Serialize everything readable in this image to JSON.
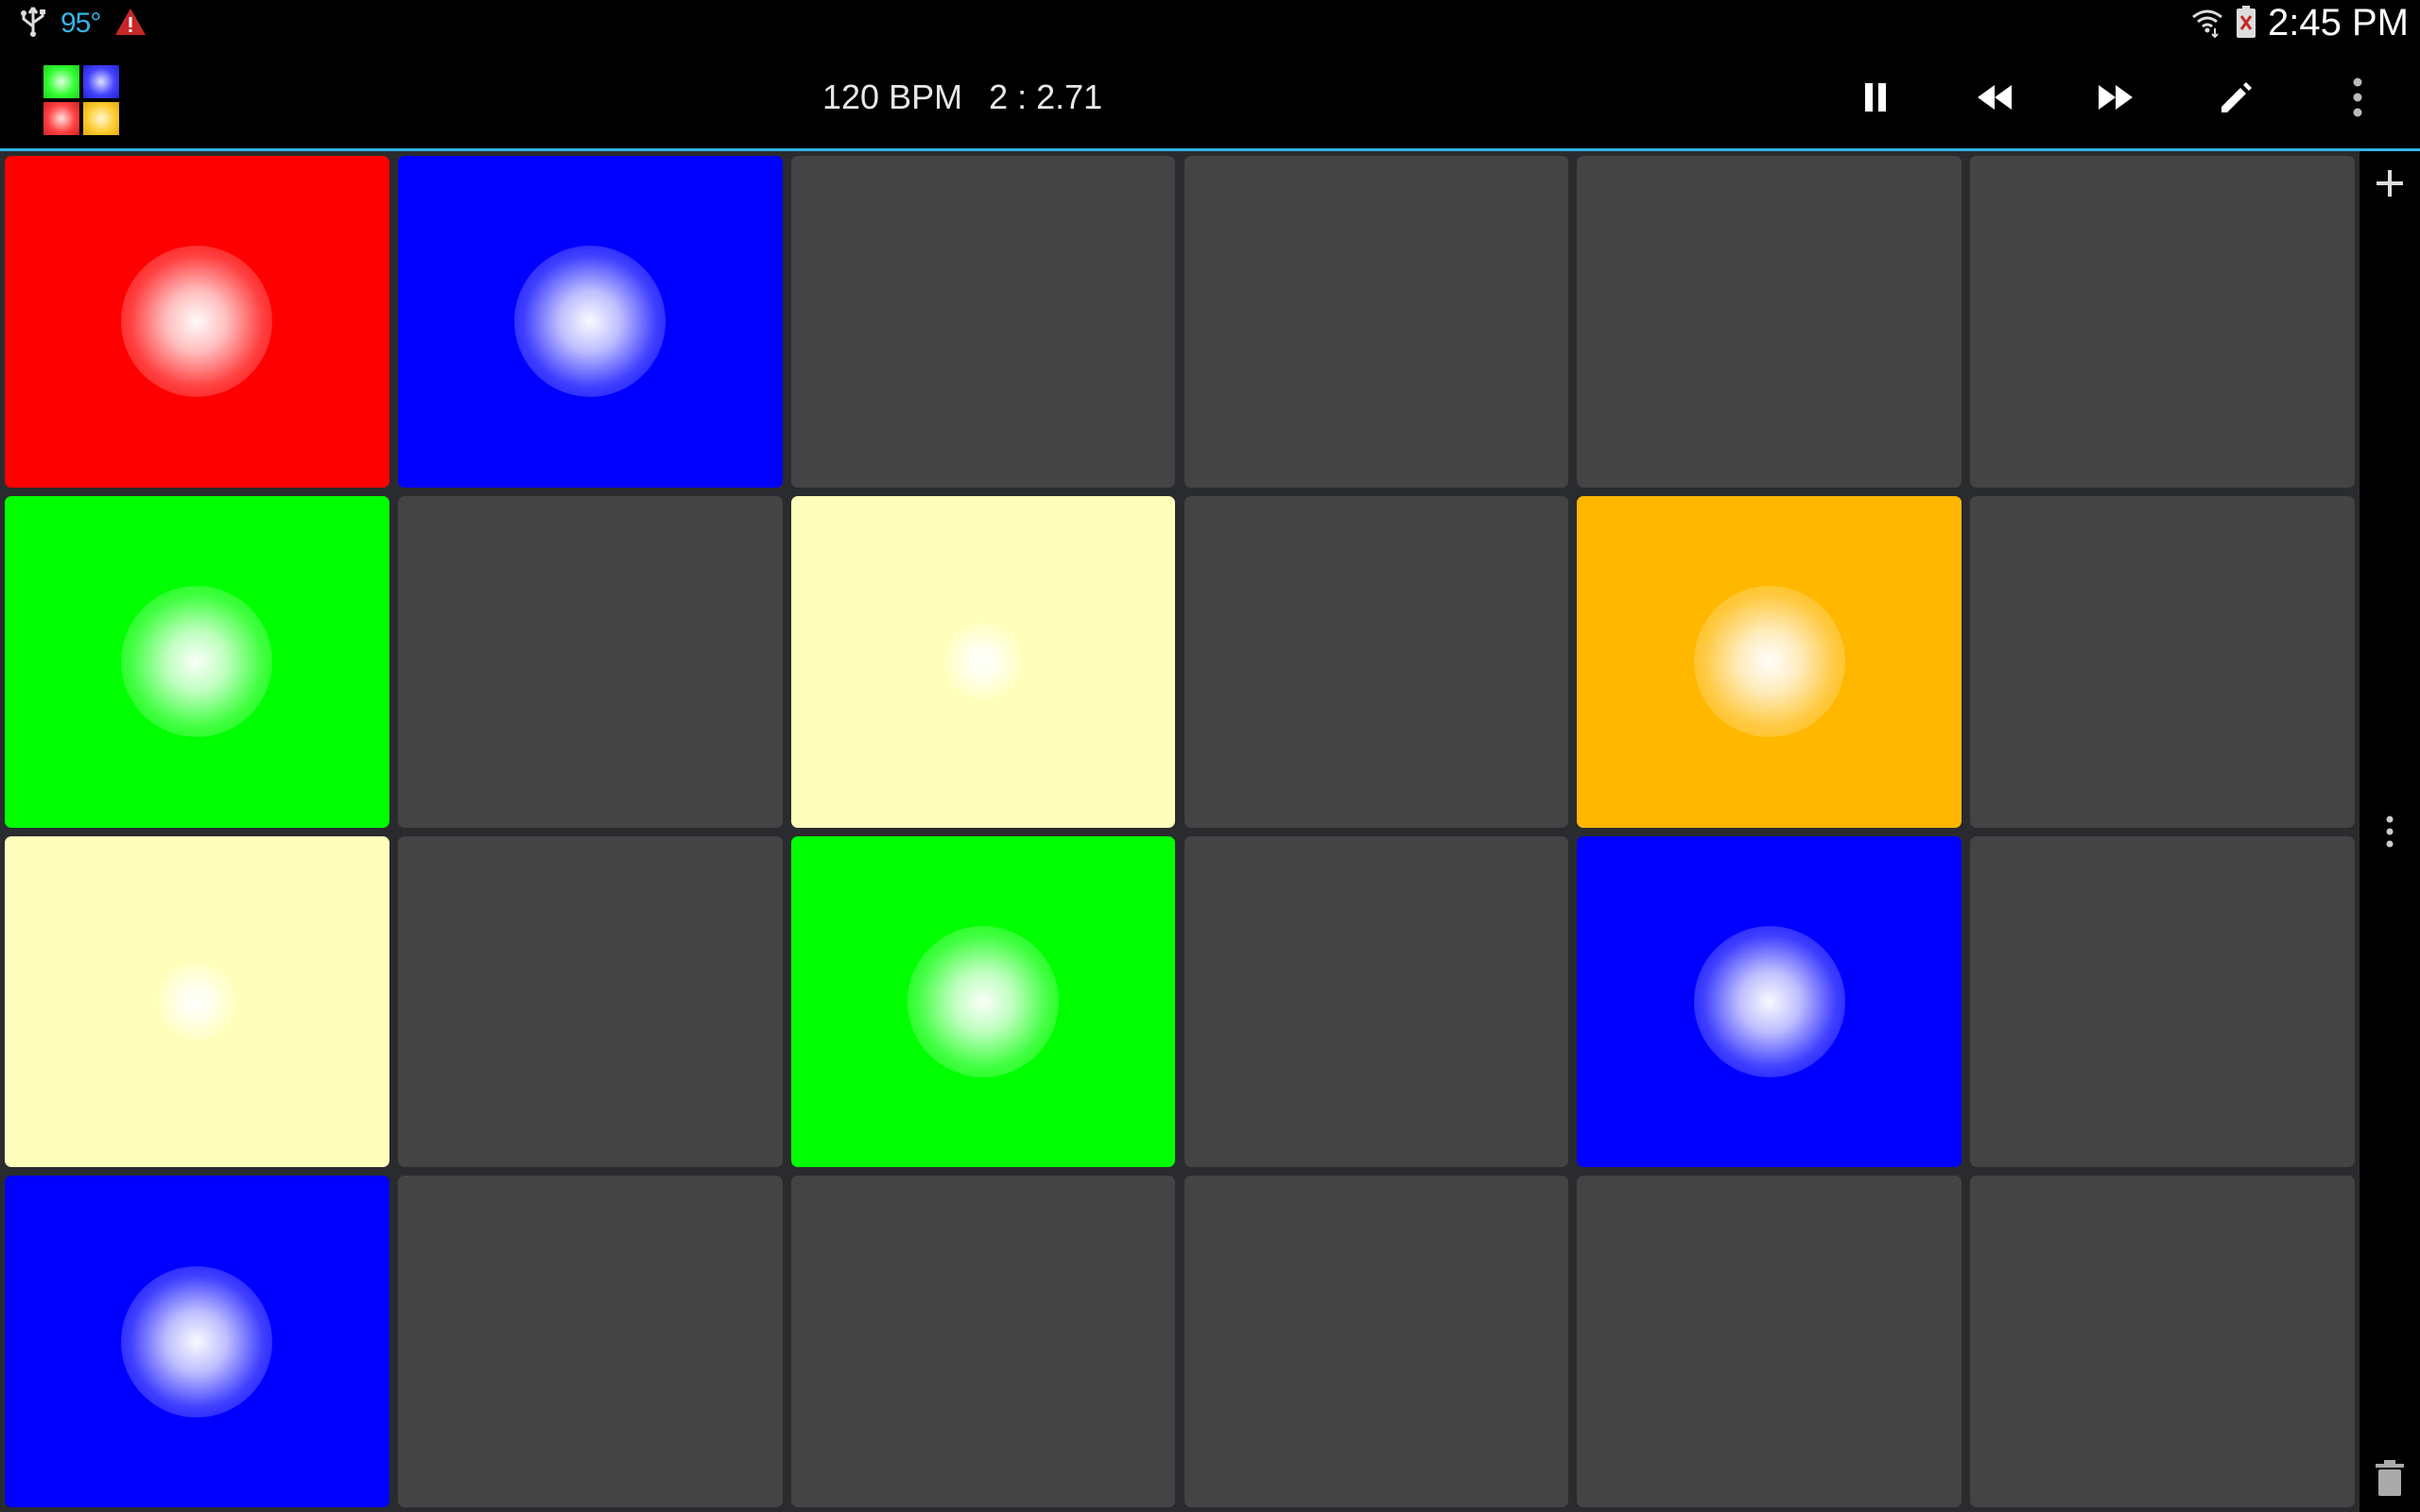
{
  "status_bar": {
    "temperature": "95°",
    "time": "2:45 PM",
    "icons": [
      "usb-icon",
      "warning-icon",
      "wifi-icon",
      "battery-icon"
    ]
  },
  "action_bar": {
    "bpm": "120 BPM",
    "position": "2 : 2.71",
    "logo_colors": [
      "#33ff33",
      "#3333ff",
      "#ff3333",
      "#ffcc33"
    ],
    "accent_color": "#33b5e5",
    "buttons": [
      "pause-icon",
      "rewind-icon",
      "fast-forward-icon",
      "edit-pencil-icon",
      "overflow-menu-icon"
    ]
  },
  "pads": {
    "columns": 6,
    "rows": 4,
    "empty_color": "#444444",
    "grid": [
      [
        "#ff0000",
        "#0000ff",
        null,
        null,
        null,
        null
      ],
      [
        "#00ff00",
        null,
        "#ffffbb",
        null,
        "#ffb700",
        null
      ],
      [
        "#ffffbb",
        null,
        "#00ff00",
        null,
        "#0000ff",
        null
      ],
      [
        "#0000ff",
        null,
        null,
        null,
        null,
        null
      ]
    ]
  },
  "side_panel": {
    "icons": [
      "add-icon",
      "vertical-dots-icon",
      "trash-icon"
    ]
  }
}
